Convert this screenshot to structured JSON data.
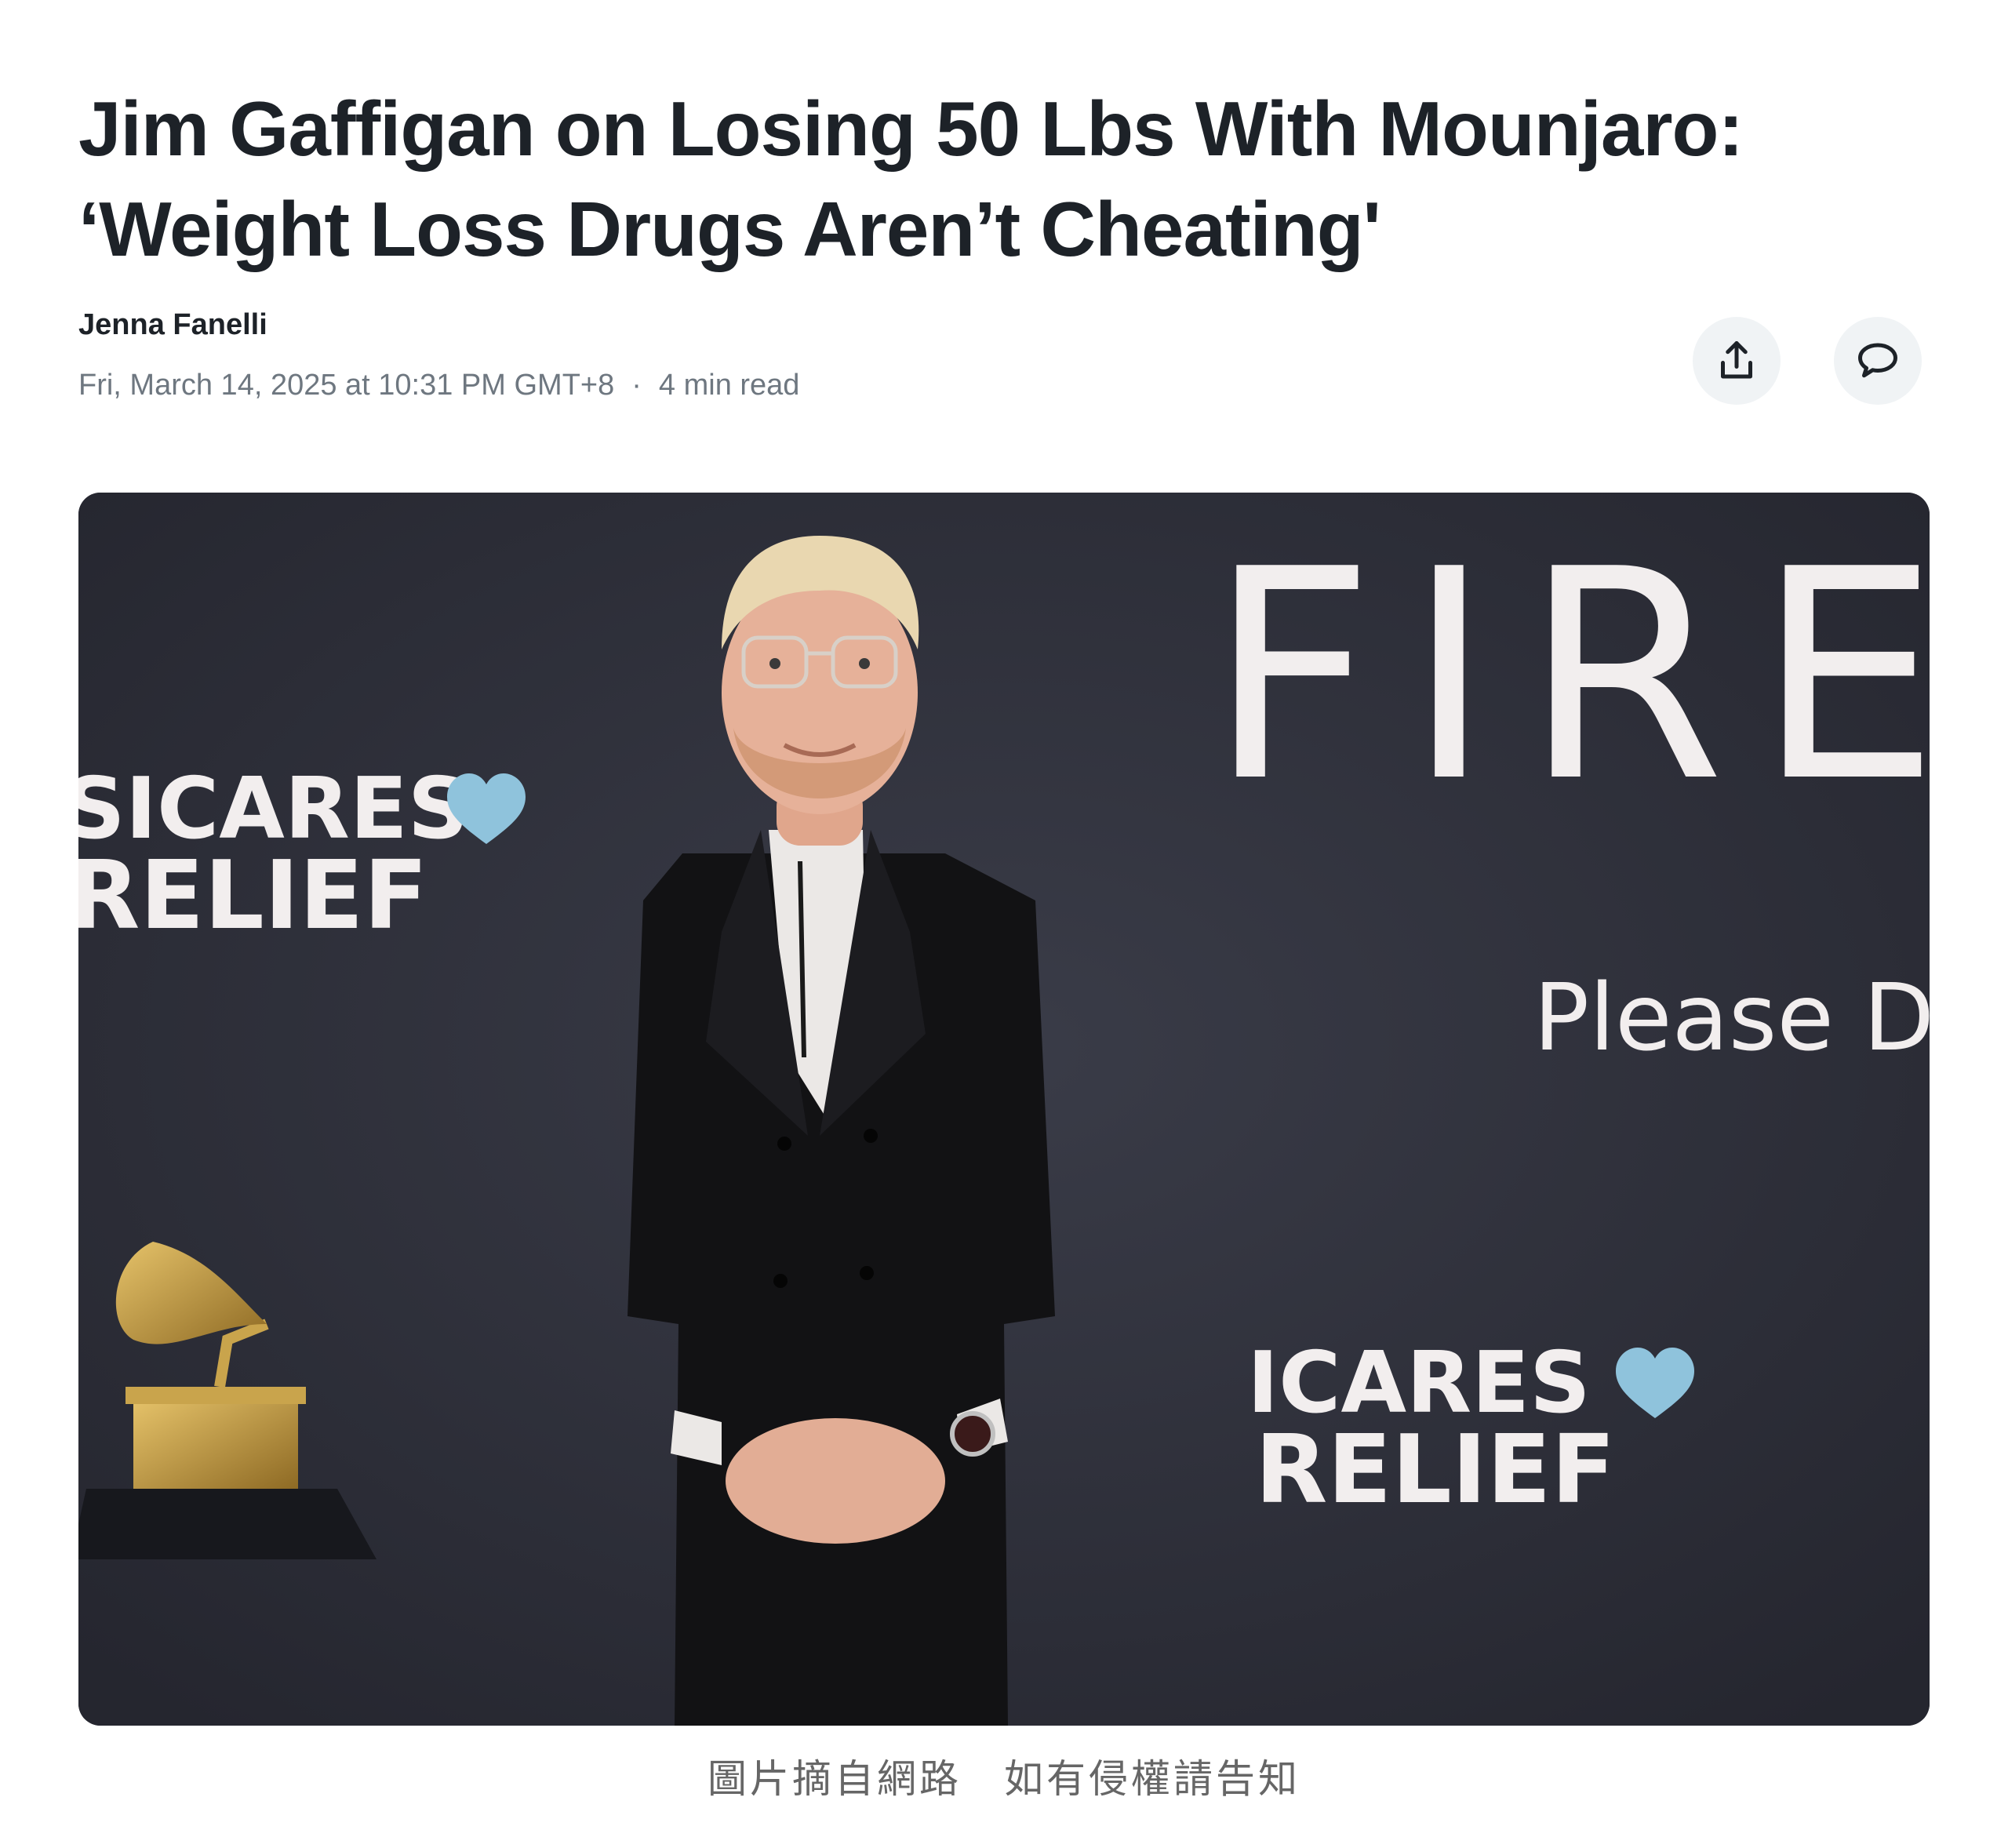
{
  "article": {
    "headline_line1": "Jim Gaffigan on Losing 50 Lbs With Mounjaro:",
    "headline_line2": "‘Weight Loss Drugs Aren’t Cheating'",
    "author": "Jenna Fanelli",
    "published": "Fri, March 14, 2025 at 10:31 PM GMT+8",
    "separator": "·",
    "read_time": "4 min read"
  },
  "actions": {
    "share_icon": "share-icon",
    "comment_icon": "comment-icon"
  },
  "hero_image": {
    "backdrop_text": {
      "fire": "FIRE",
      "please": "Please D",
      "musicares_top": "SICARES",
      "relief_top": "RELIEF",
      "musicares_bottom": "ICARES",
      "relief_bottom": "RELIEF"
    },
    "colors": {
      "backdrop": "#2d2f3a",
      "heart": "#8fc3dc",
      "gramophone": "#b8923a"
    }
  },
  "caption": "圖片摘自網路　如有侵權請告知"
}
